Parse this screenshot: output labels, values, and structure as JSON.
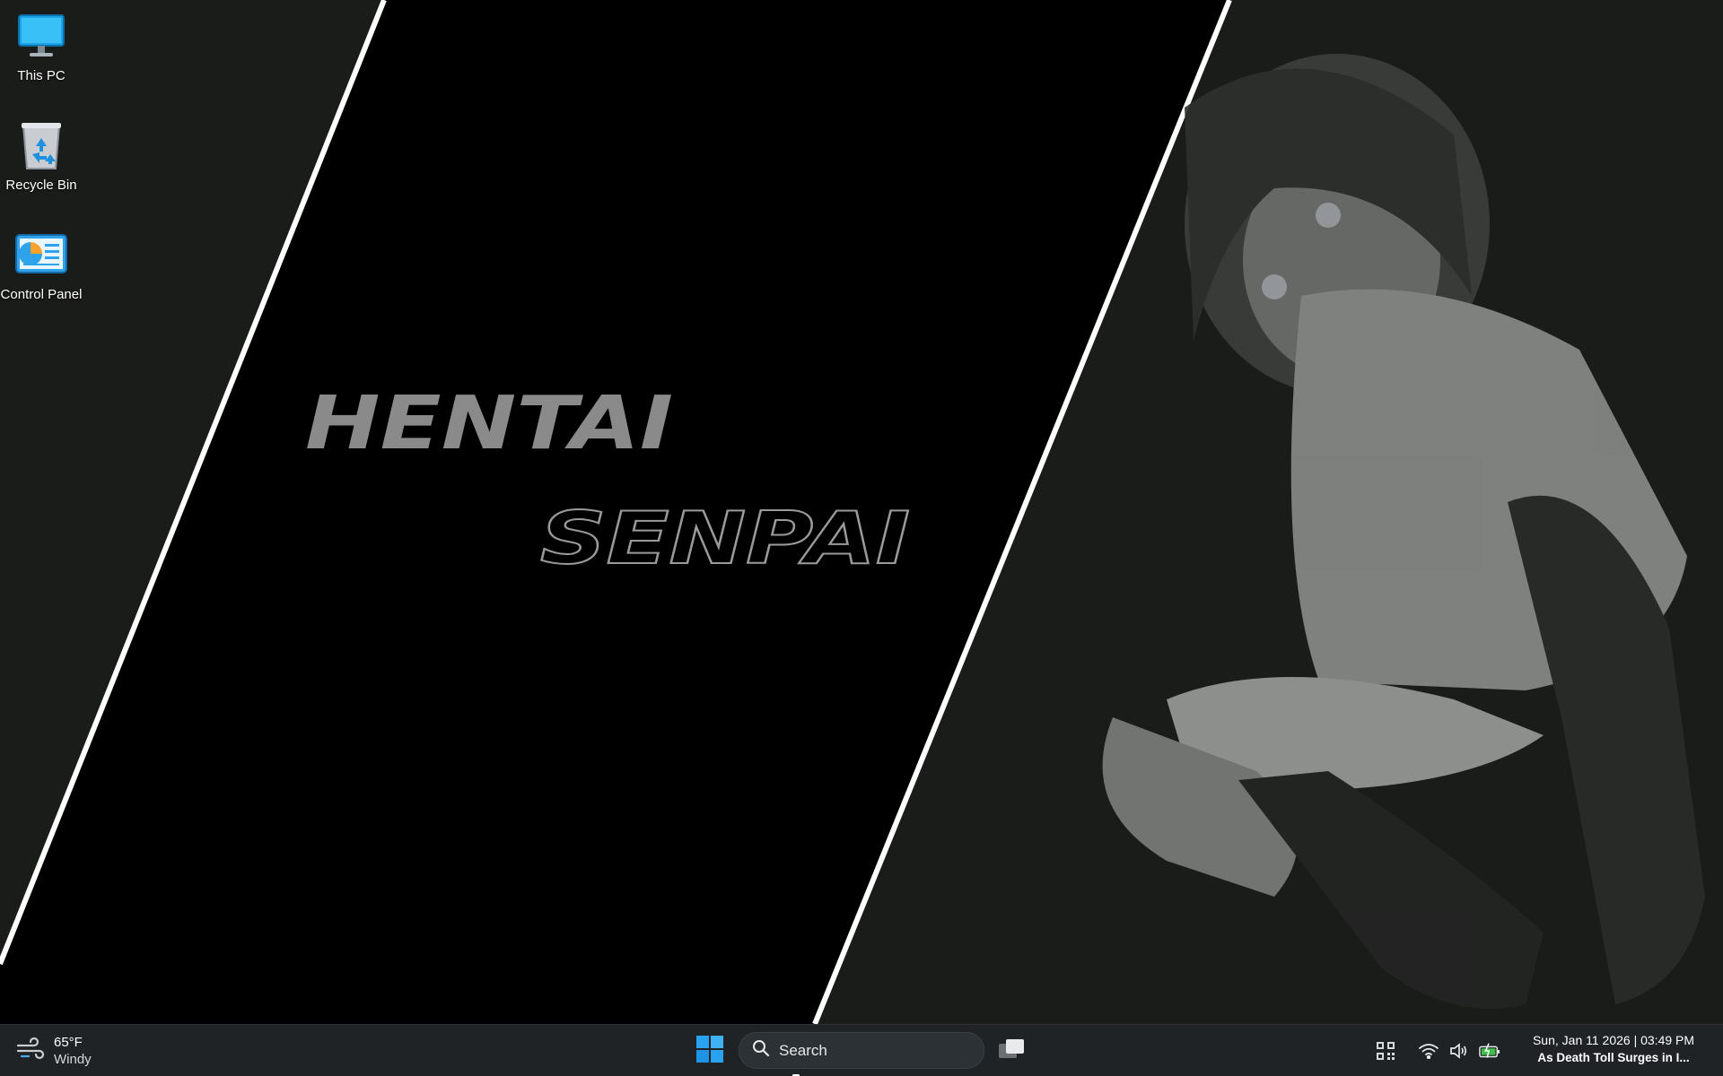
{
  "desktop": {
    "icons": [
      {
        "label": "This PC",
        "icon": "monitor-icon"
      },
      {
        "label": "Recycle Bin",
        "icon": "recycle-bin-icon"
      },
      {
        "label": "Control Panel",
        "icon": "control-panel-icon"
      }
    ],
    "wallpaper": {
      "title_line1": "HENTAI",
      "title_line2": "SENPAI",
      "panel_color": "#000000",
      "background_color": "#1a1c1a",
      "stripe_color": "#ffffff"
    }
  },
  "taskbar": {
    "weather": {
      "temperature": "65°F",
      "condition": "Windy",
      "icon": "wind-icon"
    },
    "start_icon": "windows-logo-icon",
    "search": {
      "placeholder": "Search",
      "icon": "search-icon"
    },
    "task_view_icon": "task-view-icon",
    "tray_icons": [
      "qr-code-icon",
      "wifi-icon",
      "volume-icon",
      "battery-charging-icon"
    ],
    "clock": {
      "datetime": "Sun, Jan 11 2026 | 03:49 PM",
      "news": "As Death Toll Surges in I..."
    },
    "accent_color": "#29a3f0"
  }
}
